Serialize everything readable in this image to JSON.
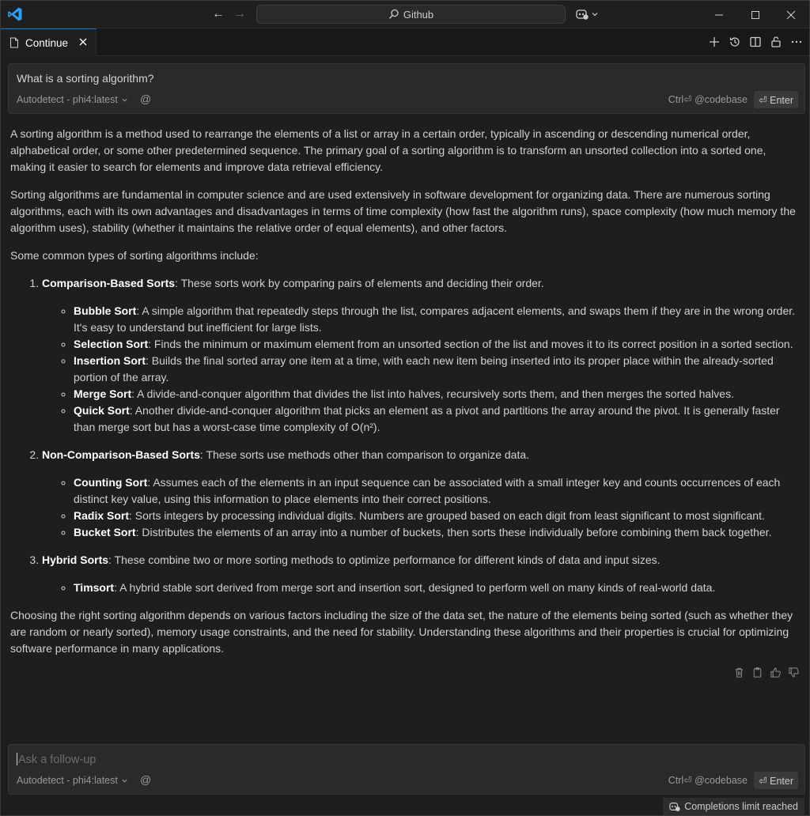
{
  "window": {
    "command_center": "Github",
    "tab_title": "Continue"
  },
  "query": {
    "text": "What is a sorting algorithm?",
    "model": "Autodetect - phi4:latest",
    "hint": "Ctrl⏎ @codebase",
    "enter": "⏎ Enter"
  },
  "response": {
    "p1": "A sorting algorithm is a method used to rearrange the elements of a list or array in a certain order, typically in ascending or descending numerical order, alphabetical order, or some other predetermined sequence. The primary goal of a sorting algorithm is to transform an unsorted collection into a sorted one, making it easier to search for elements and improve data retrieval efficiency.",
    "p2": "Sorting algorithms are fundamental in computer science and are used extensively in software development for organizing data. There are numerous sorting algorithms, each with its own advantages and disadvantages in terms of time complexity (how fast the algorithm runs), space complexity (how much memory the algorithm uses), stability (whether it maintains the relative order of equal elements), and other factors.",
    "p3": "Some common types of sorting algorithms include:",
    "groups": [
      {
        "title": "Comparison-Based Sorts",
        "desc": ": These sorts work by comparing pairs of elements and deciding their order.",
        "items": [
          {
            "name": "Bubble Sort",
            "desc": ": A simple algorithm that repeatedly steps through the list, compares adjacent elements, and swaps them if they are in the wrong order. It's easy to understand but inefficient for large lists."
          },
          {
            "name": "Selection Sort",
            "desc": ": Finds the minimum or maximum element from an unsorted section of the list and moves it to its correct position in a sorted section."
          },
          {
            "name": "Insertion Sort",
            "desc": ": Builds the final sorted array one item at a time, with each new item being inserted into its proper place within the already-sorted portion of the array."
          },
          {
            "name": "Merge Sort",
            "desc": ": A divide-and-conquer algorithm that divides the list into halves, recursively sorts them, and then merges the sorted halves."
          },
          {
            "name": "Quick Sort",
            "desc": ": Another divide-and-conquer algorithm that picks an element as a pivot and partitions the array around the pivot. It is generally faster than merge sort but has a worst-case time complexity of O(n²)."
          }
        ]
      },
      {
        "title": "Non-Comparison-Based Sorts",
        "desc": ": These sorts use methods other than comparison to organize data.",
        "items": [
          {
            "name": "Counting Sort",
            "desc": ": Assumes each of the elements in an input sequence can be associated with a small integer key and counts occurrences of each distinct key value, using this information to place elements into their correct positions."
          },
          {
            "name": "Radix Sort",
            "desc": ": Sorts integers by processing individual digits. Numbers are grouped based on each digit from least significant to most significant."
          },
          {
            "name": "Bucket Sort",
            "desc": ": Distributes the elements of an array into a number of buckets, then sorts these individually before combining them back together."
          }
        ]
      },
      {
        "title": "Hybrid Sorts",
        "desc": ": These combine two or more sorting methods to optimize performance for different kinds of data and input sizes.",
        "items": [
          {
            "name": "Timsort",
            "desc": ": A hybrid stable sort derived from merge sort and insertion sort, designed to perform well on many kinds of real-world data."
          }
        ]
      }
    ],
    "p4": "Choosing the right sorting algorithm depends on various factors including the size of the data set, the nature of the elements being sorted (such as whether they are random or nearly sorted), memory usage constraints, and the need for stability. Understanding these algorithms and their properties is crucial for optimizing software performance in many applications."
  },
  "followup": {
    "placeholder": "Ask a follow-up",
    "model": "Autodetect - phi4:latest",
    "hint": "Ctrl⏎ @codebase",
    "enter": "⏎ Enter"
  },
  "status": {
    "text": "Completions limit reached"
  }
}
